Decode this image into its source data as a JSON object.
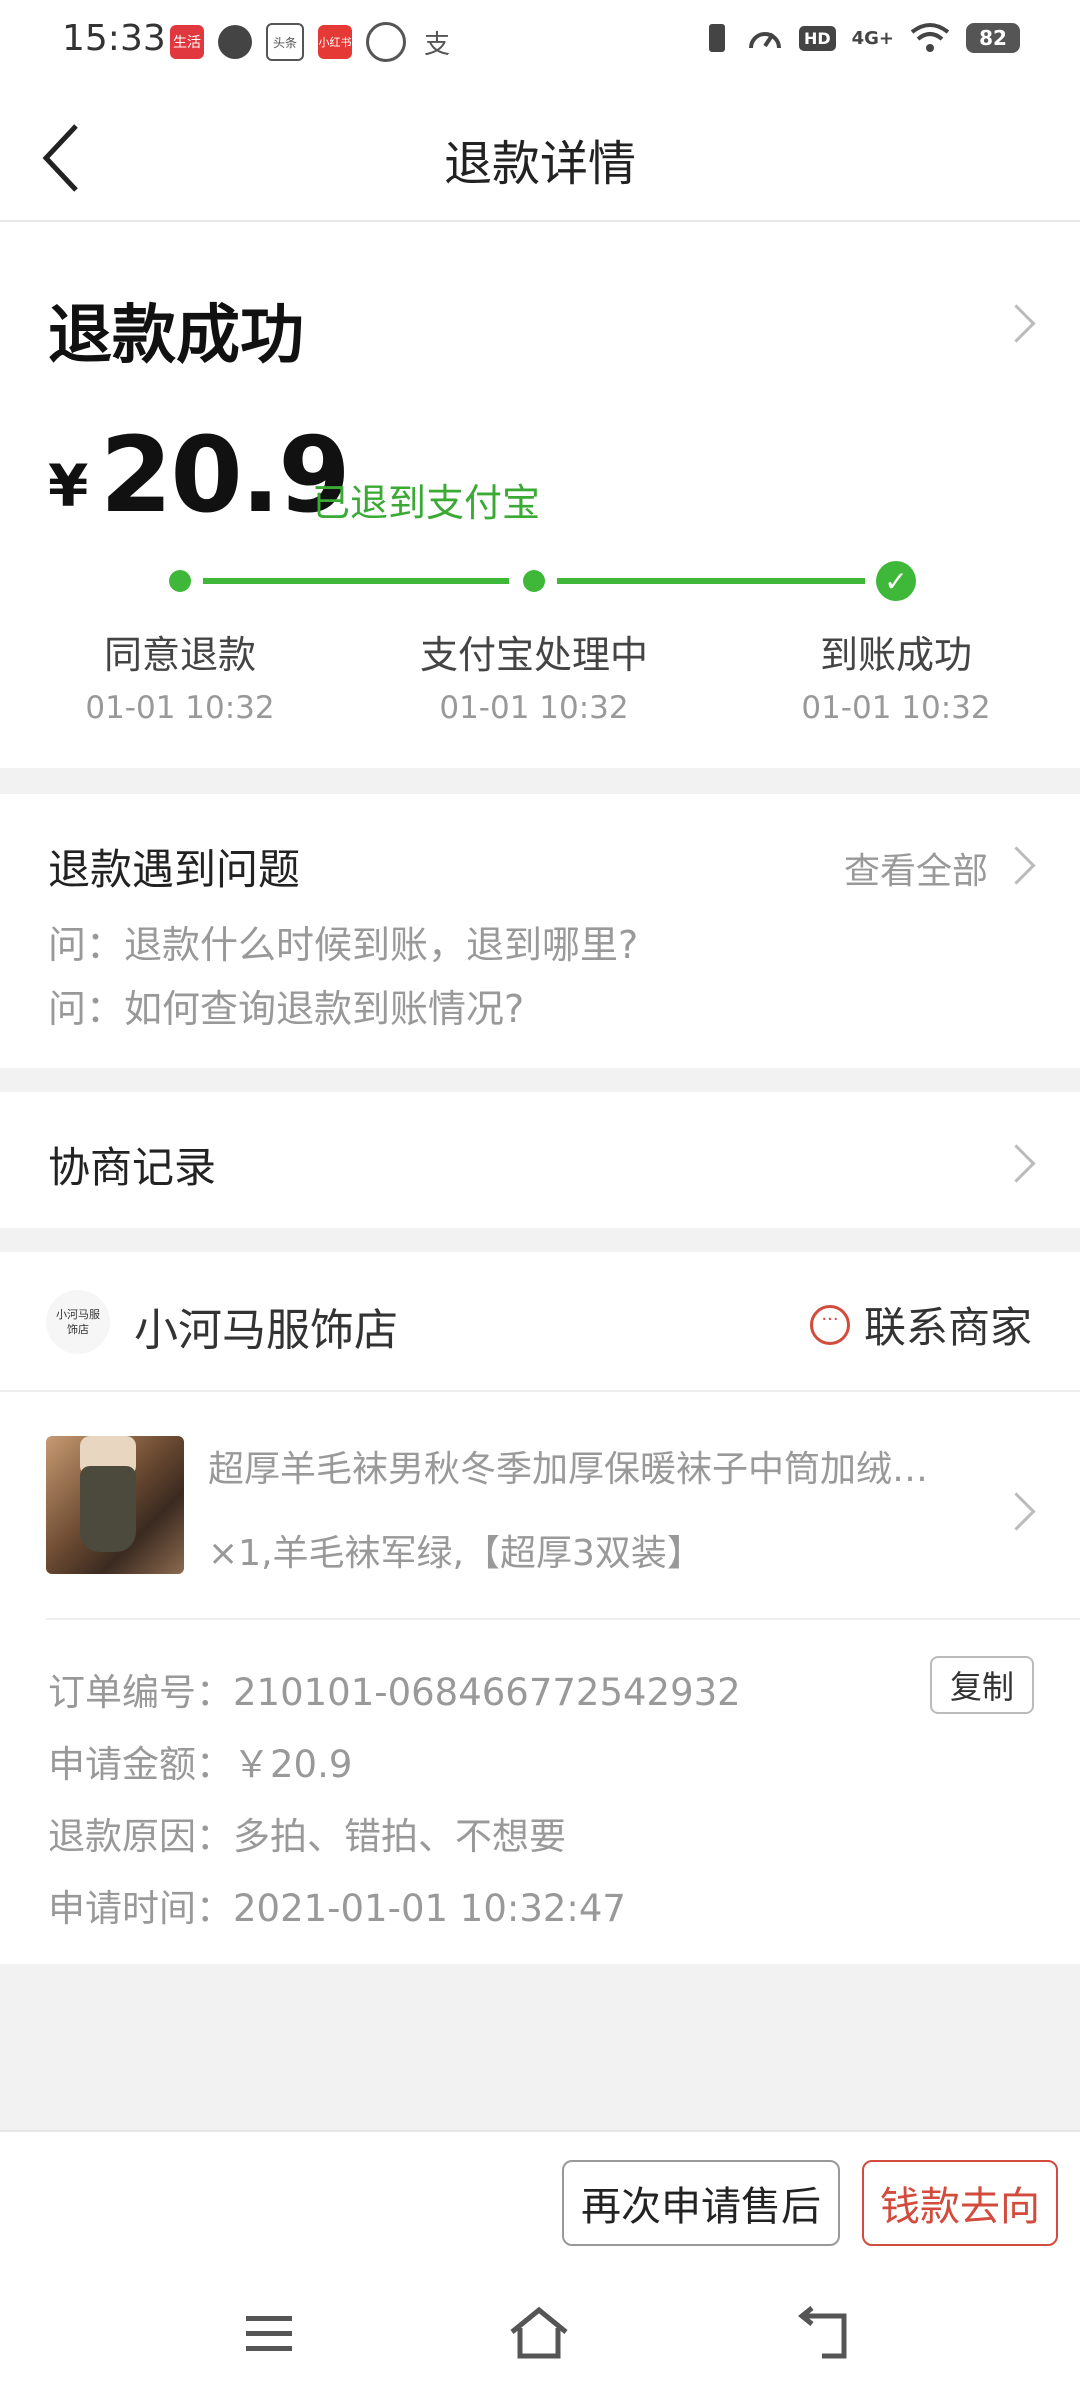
{
  "status_bar": {
    "time": "15:33",
    "apps": [
      {
        "name": "app-icon",
        "label": "生活",
        "color": "#e0383e"
      },
      {
        "name": "message-icon",
        "label": "",
        "color": "#444"
      },
      {
        "name": "toutiao-icon",
        "label": "头条",
        "color": "#555"
      },
      {
        "name": "xiaohongshu-icon",
        "label": "小红书",
        "color": "#e53935"
      },
      {
        "name": "app-icon",
        "label": "",
        "color": "#555"
      },
      {
        "name": "alipay-icon",
        "label": "支",
        "color": "#555"
      }
    ],
    "network": "4G+",
    "battery": "82"
  },
  "header": {
    "title": "退款详情"
  },
  "refund": {
    "status": "退款成功",
    "currency": "¥",
    "amount": "20.9",
    "destination": "已退到支付宝",
    "steps": [
      {
        "label": "同意退款",
        "time": "01-01 10:32"
      },
      {
        "label": "支付宝处理中",
        "time": "01-01 10:32"
      },
      {
        "label": "到账成功",
        "time": "01-01 10:32"
      }
    ]
  },
  "problems": {
    "title": "退款遇到问题",
    "view_all": "查看全部",
    "questions": [
      "问：退款什么时候到账，退到哪里?",
      "问：如何查询退款到账情况?"
    ]
  },
  "negotiation": {
    "title": "协商记录"
  },
  "shop": {
    "logo_text": "小河马服饰店",
    "name": "小河马服饰店",
    "contact": "联系商家"
  },
  "product": {
    "title": "超厚羊毛袜男秋冬季加厚保暖袜子中筒加绒…",
    "spec": "×1,羊毛袜军绿,【超厚3双装】"
  },
  "order": {
    "copy": "复制",
    "rows": [
      "订单编号：210101-068466772542932",
      "申请金额：￥20.9",
      "退款原因：多拍、错拍、不想要",
      "申请时间：2021-01-01 10:32:47"
    ]
  },
  "actions": {
    "reapply": "再次申请售后",
    "money_flow": "钱款去向"
  },
  "colors": {
    "accent_green": "#3fb83a",
    "accent_red": "#d24b3c"
  }
}
